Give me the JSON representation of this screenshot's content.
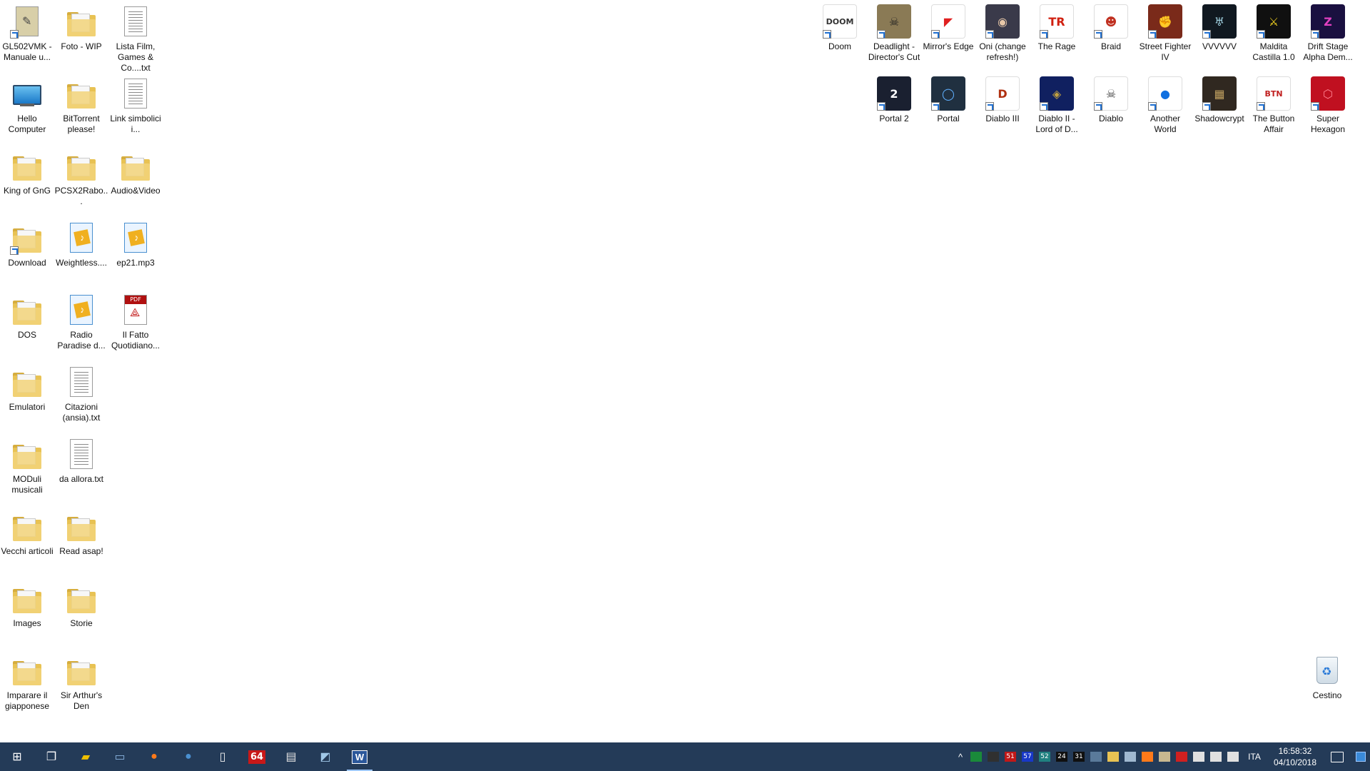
{
  "desktop": {
    "left_icons": [
      {
        "label": "GL502VMK - Manuale u...",
        "kind": "pdfdoc",
        "col": 0,
        "row": 0
      },
      {
        "label": "Foto - WIP",
        "kind": "folder",
        "col": 1,
        "row": 0
      },
      {
        "label": "Lista Film, Games & Co....txt",
        "kind": "txt",
        "col": 2,
        "row": 0
      },
      {
        "label": "Hello Computer",
        "kind": "computer",
        "col": 0,
        "row": 1
      },
      {
        "label": "BitTorrent please!",
        "kind": "folder",
        "col": 1,
        "row": 1
      },
      {
        "label": "Link simbolici i...",
        "kind": "txt",
        "col": 2,
        "row": 1
      },
      {
        "label": "King of GnG",
        "kind": "folder",
        "col": 0,
        "row": 2
      },
      {
        "label": "PCSX2Rabo...",
        "kind": "folder",
        "col": 1,
        "row": 2
      },
      {
        "label": "Audio&Video",
        "kind": "folder",
        "col": 2,
        "row": 2
      },
      {
        "label": "Download",
        "kind": "folder-shortcut",
        "col": 0,
        "row": 3
      },
      {
        "label": "Weightless....",
        "kind": "audio",
        "col": 1,
        "row": 3
      },
      {
        "label": "ep21.mp3",
        "kind": "audio",
        "col": 2,
        "row": 3
      },
      {
        "label": "DOS",
        "kind": "folder",
        "col": 0,
        "row": 4
      },
      {
        "label": "Radio Paradise d...",
        "kind": "audio",
        "col": 1,
        "row": 4
      },
      {
        "label": "Il Fatto Quotidiano...",
        "kind": "pdf",
        "col": 2,
        "row": 4
      },
      {
        "label": "Emulatori",
        "kind": "folder",
        "col": 0,
        "row": 5
      },
      {
        "label": "Citazioni (ansia).txt",
        "kind": "txt",
        "col": 1,
        "row": 5
      },
      {
        "label": "MODuli musicali",
        "kind": "folder",
        "col": 0,
        "row": 6
      },
      {
        "label": "da allora.txt",
        "kind": "txt",
        "col": 1,
        "row": 6
      },
      {
        "label": "Vecchi articoli",
        "kind": "folder",
        "col": 0,
        "row": 7
      },
      {
        "label": "Read asap!",
        "kind": "folder",
        "col": 1,
        "row": 7
      },
      {
        "label": "Images",
        "kind": "folder",
        "col": 0,
        "row": 8
      },
      {
        "label": "Storie",
        "kind": "folder",
        "col": 1,
        "row": 8
      },
      {
        "label": "Imparare il giapponese",
        "kind": "folder",
        "col": 0,
        "row": 9
      },
      {
        "label": "Sir Arthur's Den",
        "kind": "folder",
        "col": 1,
        "row": 9
      }
    ],
    "right_icons_row1": [
      {
        "label": "Doom",
        "bg": "#ffffff",
        "fg": "#333333",
        "glyph": "DOOM"
      },
      {
        "label": "Deadlight - Director's Cut",
        "bg": "#8a7a55",
        "fg": "#222222",
        "glyph": "☠"
      },
      {
        "label": "Mirror's Edge",
        "bg": "#ffffff",
        "fg": "#e02020",
        "glyph": "◤"
      },
      {
        "label": "Oni (change refresh!)",
        "bg": "#3a3a4a",
        "fg": "#e8c8a8",
        "glyph": "◉"
      },
      {
        "label": "The Rage",
        "bg": "#ffffff",
        "fg": "#d02010",
        "glyph": "TR"
      },
      {
        "label": "Braid",
        "bg": "#ffffff",
        "fg": "#c03020",
        "glyph": "☻"
      },
      {
        "label": "Street Fighter IV",
        "bg": "#7a2a1a",
        "fg": "#f0d0a0",
        "glyph": "✊"
      },
      {
        "label": "VVVVVV",
        "bg": "#101820",
        "fg": "#a0d0e0",
        "glyph": "♅"
      },
      {
        "label": "Maldita Castilla 1.0",
        "bg": "#101010",
        "fg": "#f0d020",
        "glyph": "⚔"
      },
      {
        "label": "Drift Stage Alpha Dem...",
        "bg": "#1a1040",
        "fg": "#e040c0",
        "glyph": "Z"
      }
    ],
    "right_icons_row2": [
      {
        "label": "Portal 2",
        "bg": "#1a2030",
        "fg": "#ffffff",
        "glyph": "2"
      },
      {
        "label": "Portal",
        "bg": "#203040",
        "fg": "#60b0ff",
        "glyph": "◯"
      },
      {
        "label": "Diablo III",
        "bg": "#ffffff",
        "fg": "#b03010",
        "glyph": "D"
      },
      {
        "label": "Diablo II - Lord of D...",
        "bg": "#102060",
        "fg": "#c0a040",
        "glyph": "◈"
      },
      {
        "label": "Diablo",
        "bg": "#ffffff",
        "fg": "#404040",
        "glyph": "☠"
      },
      {
        "label": "Another World",
        "bg": "#ffffff",
        "fg": "#1070e0",
        "glyph": "●"
      },
      {
        "label": "Shadowcrypt",
        "bg": "#302820",
        "fg": "#c0a060",
        "glyph": "▦"
      },
      {
        "label": "The Button Affair",
        "bg": "#ffffff",
        "fg": "#c02020",
        "glyph": "BTN"
      },
      {
        "label": "Super Hexagon",
        "bg": "#c01020",
        "fg": "#ff8090",
        "glyph": "⬡"
      }
    ],
    "recycle_bin": {
      "label": "Cestino"
    }
  },
  "taskbar": {
    "pinned": [
      {
        "name": "start-button",
        "glyph": "⊞",
        "color": "#ffffff"
      },
      {
        "name": "task-view-button",
        "glyph": "❐",
        "color": "#ffffff"
      },
      {
        "name": "file-explorer-icon",
        "glyph": "▰",
        "color": "#f0c000"
      },
      {
        "name": "remote-desktop-icon",
        "glyph": "▭",
        "color": "#8ab4e0"
      },
      {
        "name": "firefox-icon",
        "glyph": "●",
        "color": "#ff7a1a"
      },
      {
        "name": "thunderbird-icon",
        "glyph": "●",
        "color": "#4a90d0"
      },
      {
        "name": "reader-icon",
        "glyph": "▯",
        "color": "#f0f0f0"
      },
      {
        "name": "c64-emulator-icon",
        "glyph": "64",
        "color": "#ffffff"
      },
      {
        "name": "notepad-icon",
        "glyph": "▤",
        "color": "#e0e0e0"
      },
      {
        "name": "app-icon",
        "glyph": "◩",
        "color": "#a0c8e8"
      },
      {
        "name": "word-icon",
        "glyph": "W",
        "color": "#ffffff"
      }
    ],
    "tray": {
      "overflow": "^",
      "icons": [
        {
          "name": "tray-green-icon",
          "text": "",
          "bg": "#1a8a3a"
        },
        {
          "name": "tray-monitor-icon",
          "text": "",
          "bg": "#303030"
        },
        {
          "name": "tray-temp1-icon",
          "text": "51",
          "bg": "#c01818"
        },
        {
          "name": "tray-temp2-icon",
          "text": "57",
          "bg": "#1838c8"
        },
        {
          "name": "tray-temp3-icon",
          "text": "52",
          "bg": "#208080"
        },
        {
          "name": "tray-temp4-icon",
          "text": "24",
          "bg": "#101010"
        },
        {
          "name": "tray-temp5-icon",
          "text": "31",
          "bg": "#101010"
        },
        {
          "name": "tray-steam-icon",
          "text": "",
          "bg": "#5a7a9a"
        },
        {
          "name": "tray-folder-icon",
          "text": "",
          "bg": "#e8c253"
        },
        {
          "name": "tray-window-icon",
          "text": "",
          "bg": "#a0b8d0"
        },
        {
          "name": "tray-firefox-icon",
          "text": "",
          "bg": "#ff7a1a"
        },
        {
          "name": "tray-book-icon",
          "text": "",
          "bg": "#c8b890"
        },
        {
          "name": "tray-acrobat-icon",
          "text": "",
          "bg": "#d02020"
        },
        {
          "name": "tray-network-icon",
          "text": "",
          "bg": "#e0e0e0"
        },
        {
          "name": "tray-battery-icon",
          "text": "",
          "bg": "#e0e0e0"
        },
        {
          "name": "tray-volume-icon",
          "text": "",
          "bg": "#e0e0e0"
        }
      ],
      "language": "ITA",
      "time": "16:58:32",
      "date": "04/10/2018"
    }
  }
}
